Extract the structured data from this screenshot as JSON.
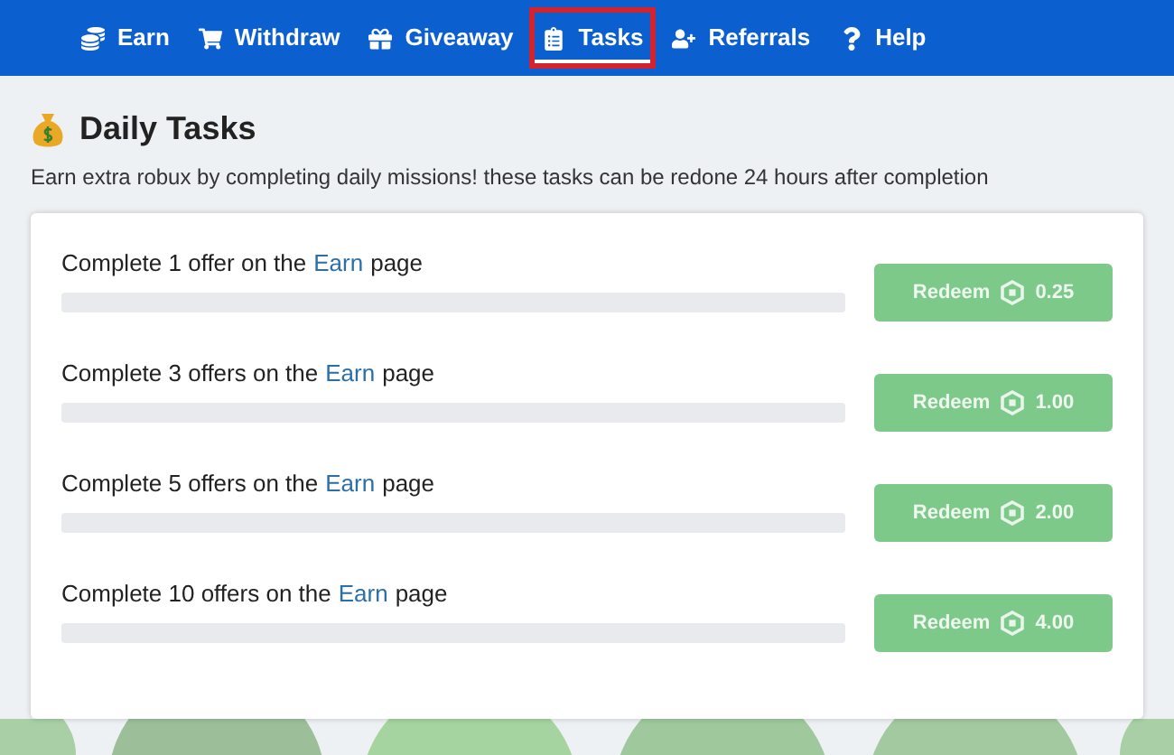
{
  "nav": {
    "items": [
      {
        "label": "Earn",
        "selected": false
      },
      {
        "label": "Withdraw",
        "selected": false
      },
      {
        "label": "Giveaway",
        "selected": false
      },
      {
        "label": "Tasks",
        "selected": true
      },
      {
        "label": "Referrals",
        "selected": false
      },
      {
        "label": "Help",
        "selected": false
      }
    ]
  },
  "title": "Daily Tasks",
  "subtitle": "Earn extra robux by completing daily missions! these tasks can be redone 24 hours after completion",
  "tasks": [
    {
      "before": "Complete 1 offer on the",
      "link": "Earn",
      "after": "page",
      "level": 0,
      "button": "Redeem",
      "reward": "0.25",
      "disabled": true
    },
    {
      "before": "Complete 3 offers on the",
      "link": "Earn",
      "after": "page",
      "level": 0,
      "button": "Redeem",
      "reward": "1.00",
      "disabled": true
    },
    {
      "before": "Complete 5 offers on the",
      "link": "Earn",
      "after": "page",
      "level": 0,
      "button": "Redeem",
      "reward": "2.00",
      "disabled": true
    },
    {
      "before": "Complete 10 offers on the",
      "link": "Earn",
      "after": "page",
      "level": 0,
      "button": "Redeem",
      "reward": "4.00",
      "disabled": true
    }
  ]
}
